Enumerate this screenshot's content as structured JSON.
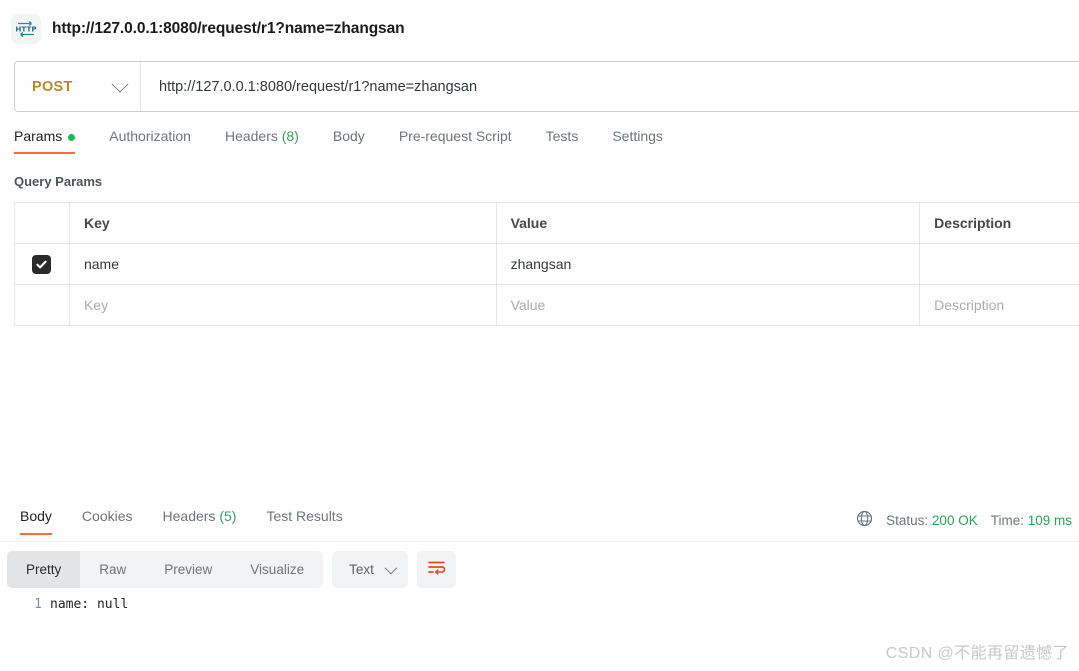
{
  "header": {
    "icon": "http-icon",
    "title": "http://127.0.0.1:8080/request/r1?name=zhangsan"
  },
  "request_bar": {
    "method": "POST",
    "method_dropdown_icon": "chevron-down-icon",
    "url": "http://127.0.0.1:8080/request/r1?name=zhangsan"
  },
  "request_tabs": [
    {
      "label": "Params",
      "badge": "",
      "dot": true,
      "active": true
    },
    {
      "label": "Authorization",
      "badge": "",
      "dot": false,
      "active": false
    },
    {
      "label": "Headers",
      "badge": "(8)",
      "dot": false,
      "active": false
    },
    {
      "label": "Body",
      "badge": "",
      "dot": false,
      "active": false
    },
    {
      "label": "Pre-request Script",
      "badge": "",
      "dot": false,
      "active": false
    },
    {
      "label": "Tests",
      "badge": "",
      "dot": false,
      "active": false
    },
    {
      "label": "Settings",
      "badge": "",
      "dot": false,
      "active": false
    }
  ],
  "query_params": {
    "section_label": "Query Params",
    "columns": [
      "Key",
      "Value",
      "Description"
    ],
    "rows": [
      {
        "checked": true,
        "key": "name",
        "value": "zhangsan",
        "description": ""
      }
    ],
    "placeholder_row": {
      "key": "Key",
      "value": "Value",
      "description": "Description"
    }
  },
  "response": {
    "tabs": [
      {
        "label": "Body",
        "badge": "",
        "active": true
      },
      {
        "label": "Cookies",
        "badge": "",
        "active": false
      },
      {
        "label": "Headers",
        "badge": "(5)",
        "active": false
      },
      {
        "label": "Test Results",
        "badge": "",
        "active": false
      }
    ],
    "globe_icon": "globe-icon",
    "status_label": "Status:",
    "status_value": "200 OK",
    "time_label": "Time:",
    "time_value": "109 ms",
    "view_modes": [
      {
        "label": "Pretty",
        "active": true
      },
      {
        "label": "Raw",
        "active": false
      },
      {
        "label": "Preview",
        "active": false
      },
      {
        "label": "Visualize",
        "active": false
      }
    ],
    "format": "Text",
    "format_dropdown_icon": "chevron-down-icon",
    "wrap_icon": "word-wrap-icon",
    "body_lines": [
      {
        "number": "1",
        "text": "name: null"
      }
    ]
  },
  "watermark": "CSDN @不能再留遗憾了",
  "colors": {
    "accent": "#ff6c37",
    "method": "#b5892a",
    "success": "#2e9e5b",
    "dot": "#1db954"
  }
}
